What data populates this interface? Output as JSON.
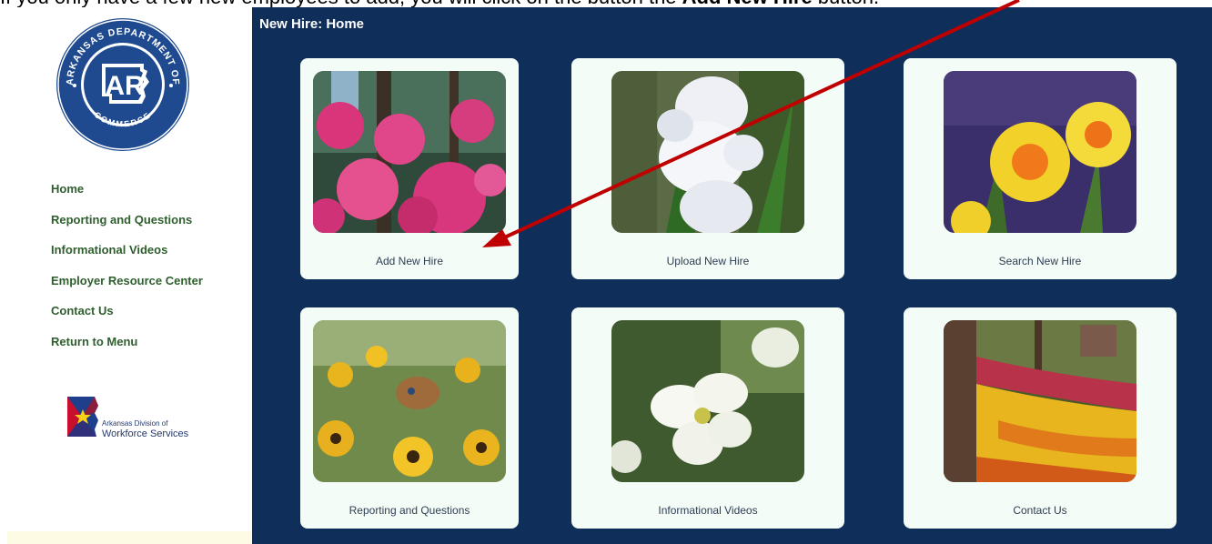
{
  "instruction": {
    "prefix": "If you only have a few new employees to add, you will click on the button the ",
    "bold": "Add New Hire",
    "suffix": " button."
  },
  "sidebar": {
    "seal": {
      "top_text": "ARKANSAS DEPARTMENT OF",
      "bottom_text": "COMMERCE",
      "center_text": "AR"
    },
    "nav": [
      {
        "label": "Home"
      },
      {
        "label": "Reporting and Questions"
      },
      {
        "label": "Informational Videos"
      },
      {
        "label": "Employer Resource Center"
      },
      {
        "label": "Contact Us"
      },
      {
        "label": "Return to Menu"
      }
    ],
    "dws_logo": {
      "line1": "Arkansas Division of",
      "line2": "Workforce Services"
    }
  },
  "main": {
    "title": "New Hire: Home",
    "tiles": [
      {
        "label": "Add New Hire",
        "image": "pink-azaleas-photo"
      },
      {
        "label": "Upload New Hire",
        "image": "white-hyacinth-photo"
      },
      {
        "label": "Search New Hire",
        "image": "yellow-daffodil-photo"
      },
      {
        "label": "Reporting and Questions",
        "image": "black-eyed-susan-butterfly-photo"
      },
      {
        "label": "Informational Videos",
        "image": "white-dogwood-photo"
      },
      {
        "label": "Contact Us",
        "image": "tulip-garden-photo"
      }
    ]
  },
  "colors": {
    "main_bg": "#0f2e59",
    "nav_text": "#2e5e2e",
    "tile_bg": "#f4fcf8",
    "annotation_arrow": "#c00000"
  }
}
